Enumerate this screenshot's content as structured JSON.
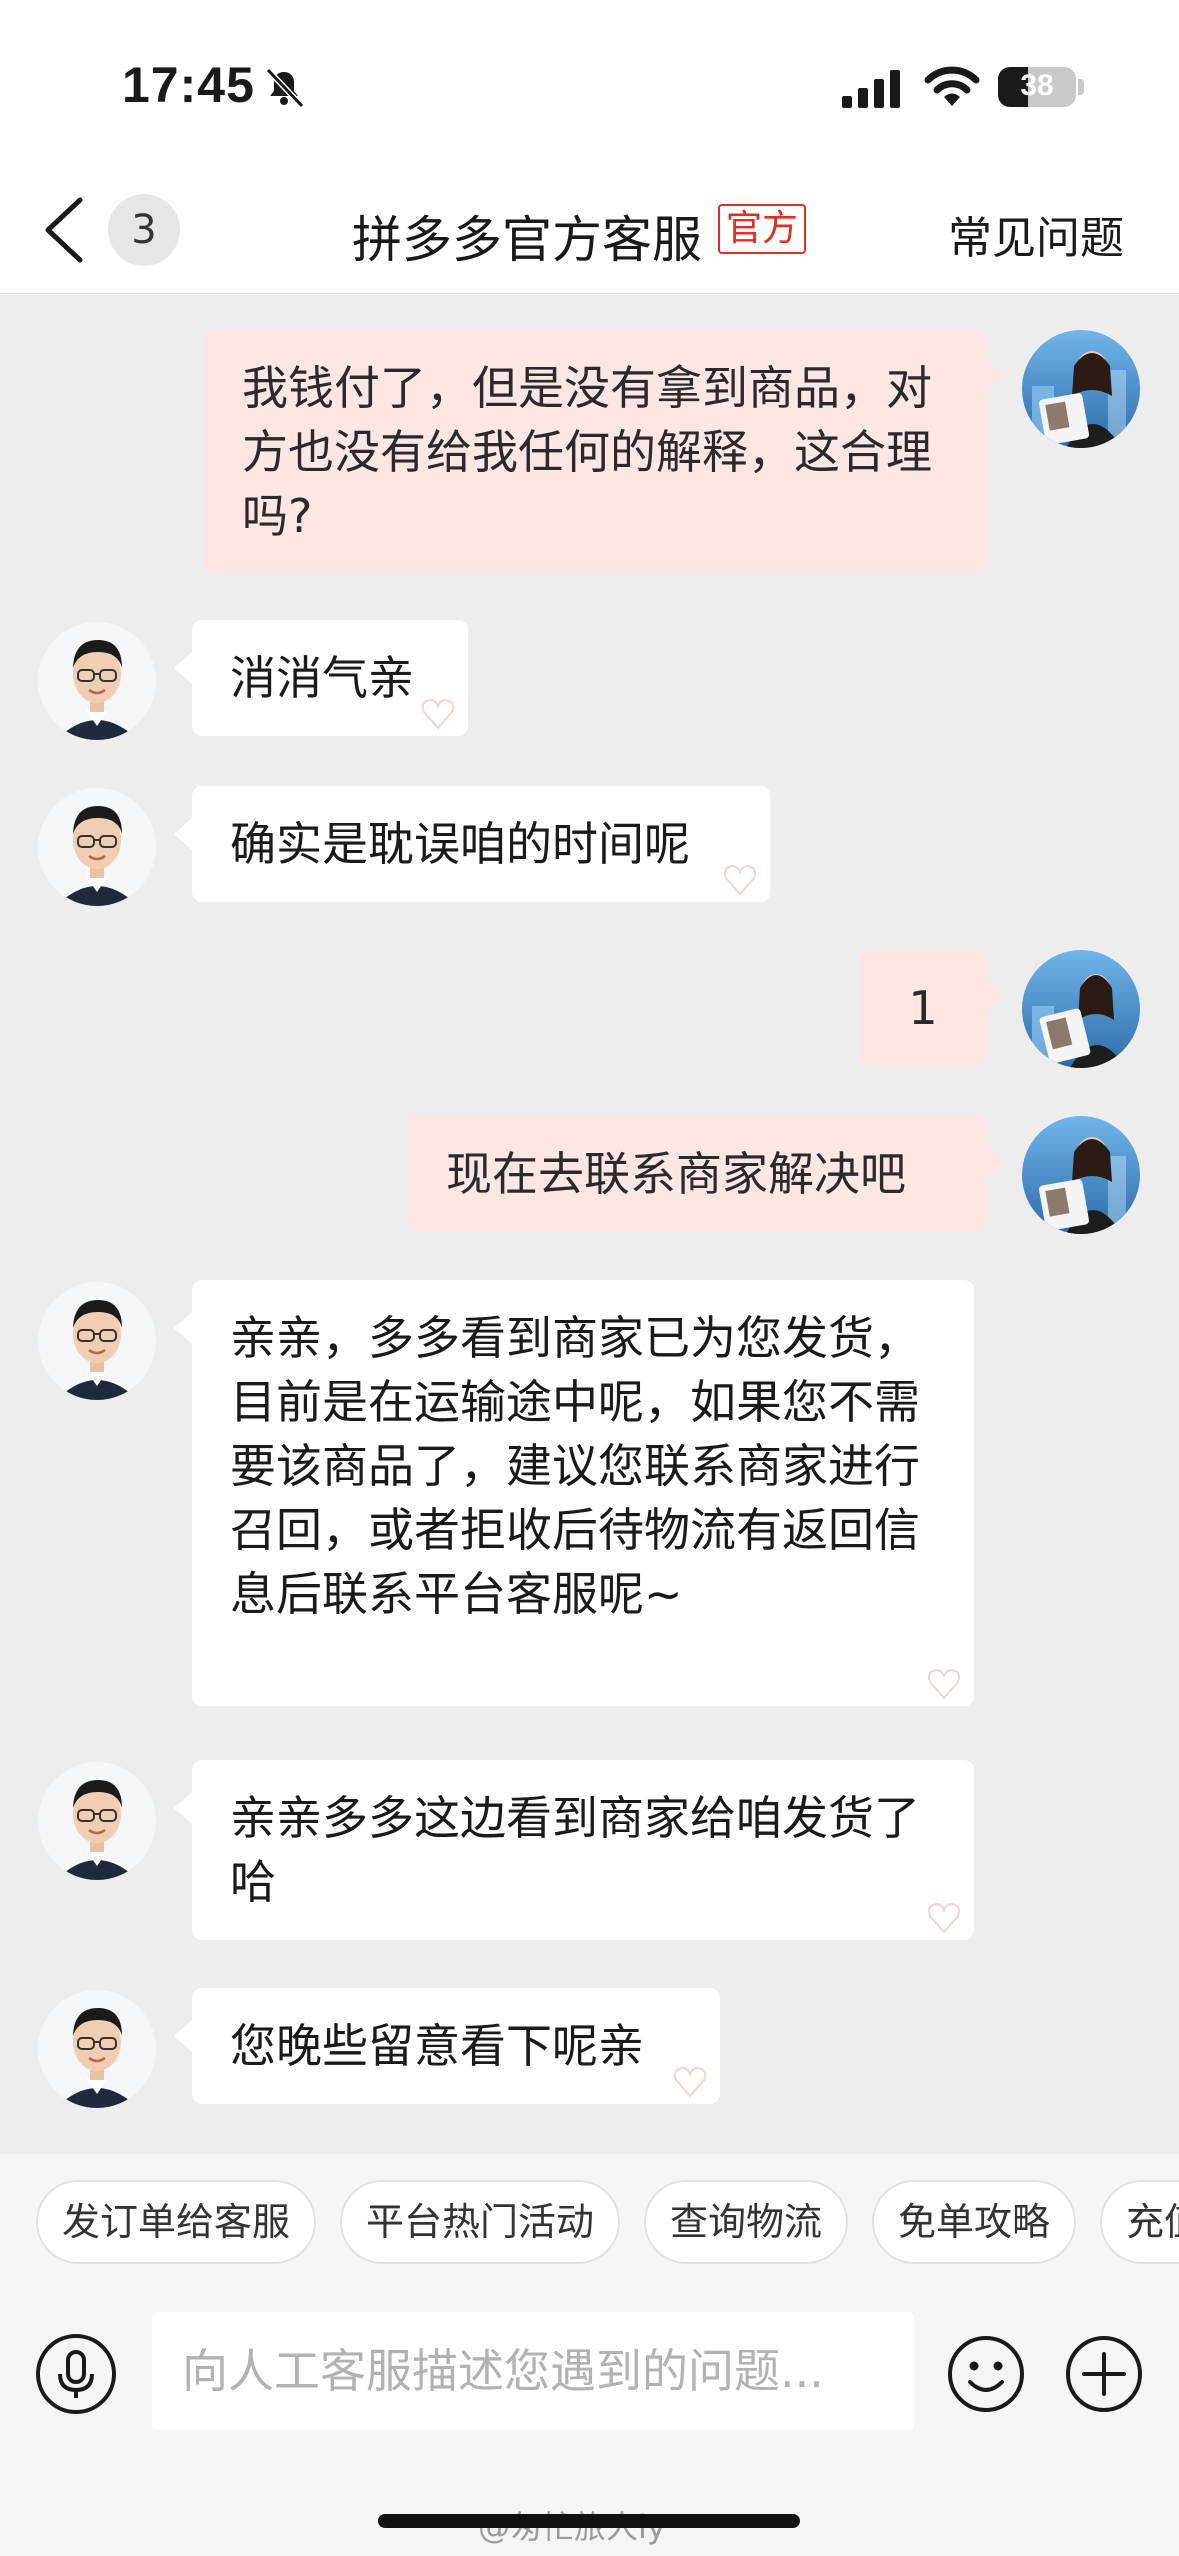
{
  "status_bar": {
    "time": "17:45",
    "battery": "38"
  },
  "nav": {
    "unread_count": "3",
    "title": "拼多多官方客服",
    "official_tag": "官方",
    "faq_label": "常见问题"
  },
  "messages": [
    {
      "side": "out",
      "text": "我钱付了，但是没有拿到商品，对方也没有给我任何的解释，这合理吗?"
    },
    {
      "side": "in",
      "text": "消消气亲"
    },
    {
      "side": "in",
      "text": "确实是耽误咱的时间呢"
    },
    {
      "side": "out",
      "text": "1"
    },
    {
      "side": "out",
      "text": "现在去联系商家解决吧"
    },
    {
      "side": "in",
      "text": "亲亲，多多看到商家已为您发货，目前是在运输途中呢，如果您不需要该商品了，建议您联系商家进行召回，或者拒收后待物流有返回信息后联系平台客服呢~"
    },
    {
      "side": "in",
      "text": "亲亲多多这边看到商家给咱发货了哈"
    },
    {
      "side": "in",
      "text": "您晚些留意看下呢亲"
    }
  ],
  "quick_replies": [
    "发订单给客服",
    "平台热门活动",
    "查询物流",
    "免单攻略",
    "充值"
  ],
  "input": {
    "placeholder": "向人工客服描述您遇到的问题..."
  },
  "watermark": "@匆忙旅人ly",
  "colors": {
    "brand_red": "#e02e24",
    "outgoing_bubble": "#fde6e4",
    "incoming_bubble": "#ffffff",
    "chat_background": "#ededed"
  },
  "icons": {
    "status": [
      "bell-muted-icon",
      "signal-icon",
      "wifi-icon",
      "battery-icon"
    ],
    "nav": [
      "back-chevron-icon"
    ],
    "input": [
      "microphone-icon",
      "emoji-icon",
      "plus-icon"
    ]
  }
}
